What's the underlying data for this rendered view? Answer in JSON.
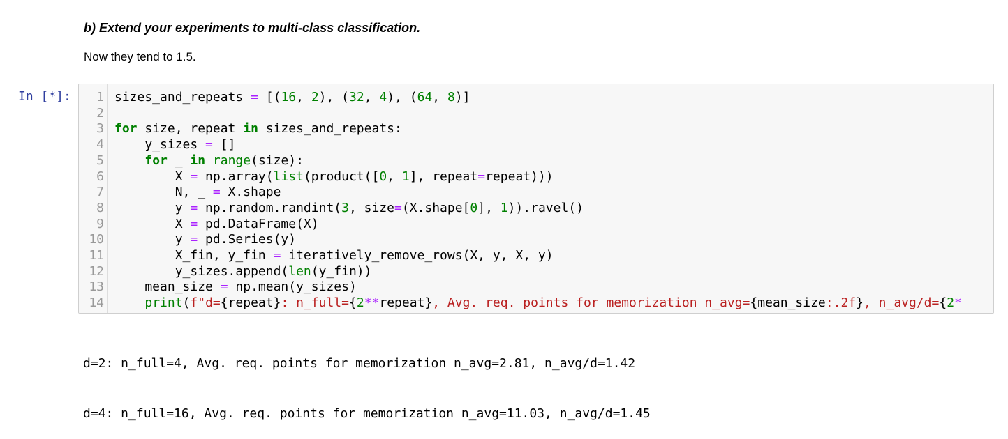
{
  "markdown": {
    "heading": "b) Extend your experiments to multi-class classification.",
    "text": "Now they tend to 1.5."
  },
  "cell": {
    "prompt": "In [*]:",
    "line_numbers": [
      "1",
      "2",
      "3",
      "4",
      "5",
      "6",
      "7",
      "8",
      "9",
      "10",
      "11",
      "12",
      "13",
      "14"
    ],
    "code_lines": [
      "sizes_and_repeats = [(16, 2), (32, 4), (64, 8)]",
      "",
      "for size, repeat in sizes_and_repeats:",
      "    y_sizes = []",
      "    for _ in range(size):",
      "        X = np.array(list(product([0, 1], repeat=repeat)))",
      "        N, _ = X.shape",
      "        y = np.random.randint(3, size=(X.shape[0], 1)).ravel()",
      "        X = pd.DataFrame(X)",
      "        y = pd.Series(y)",
      "        X_fin, y_fin = iteratively_remove_rows(X, y, X, y)",
      "        y_sizes.append(len(y_fin))",
      "    mean_size = np.mean(y_sizes)",
      "    print(f\"d={repeat}: n_full={2**repeat}, Avg. req. points for memorization n_avg={mean_size:.2f}, n_avg/d={2*"
    ]
  },
  "output": {
    "lines": [
      "d=2: n_full=4, Avg. req. points for memorization n_avg=2.81, n_avg/d=1.42",
      "d=4: n_full=16, Avg. req. points for memorization n_avg=11.03, n_avg/d=1.45"
    ]
  },
  "colors": {
    "keyword": "#008000",
    "operator": "#aa22ff",
    "string": "#ba2121",
    "prompt": "#303f9f",
    "cell_background": "#f7f7f7"
  }
}
